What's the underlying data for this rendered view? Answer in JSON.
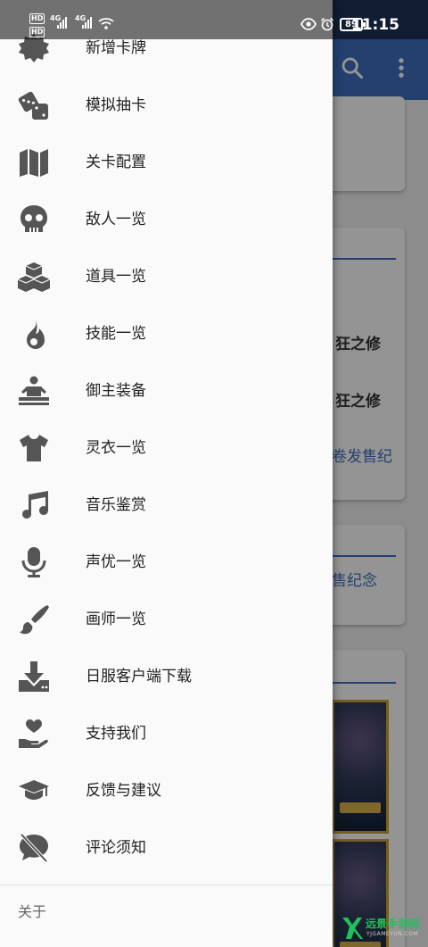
{
  "status_bar": {
    "hd_badges": [
      "HD",
      "HD"
    ],
    "network_labels": [
      "4G",
      "4G"
    ],
    "battery": "89",
    "time": "11:15"
  },
  "background": {
    "appbar_icons": [
      "search-icon",
      "more-vert-icon"
    ],
    "card_lines": [
      "狂之修",
      "狂之修"
    ],
    "link_lines": [
      "卷发售纪",
      "售纪念"
    ]
  },
  "drawer": {
    "items": [
      {
        "label": "新增卡牌",
        "icon": "gear-badge-icon"
      },
      {
        "label": "模拟抽卡",
        "icon": "dice-icon"
      },
      {
        "label": "关卡配置",
        "icon": "map-icon"
      },
      {
        "label": "敌人一览",
        "icon": "skull-icon"
      },
      {
        "label": "道具一览",
        "icon": "cubes-icon"
      },
      {
        "label": "技能一览",
        "icon": "flame-icon"
      },
      {
        "label": "御主装备",
        "icon": "person-table-icon"
      },
      {
        "label": "灵衣一览",
        "icon": "tshirt-icon"
      },
      {
        "label": "音乐鉴赏",
        "icon": "music-note-icon"
      },
      {
        "label": "声优一览",
        "icon": "microphone-icon"
      },
      {
        "label": "画师一览",
        "icon": "paintbrush-icon"
      },
      {
        "label": "日服客户端下载",
        "icon": "download-icon"
      },
      {
        "label": "支持我们",
        "icon": "hand-heart-icon"
      },
      {
        "label": "反馈与建议",
        "icon": "graduation-cap-icon"
      },
      {
        "label": "评论须知",
        "icon": "comment-off-icon"
      }
    ],
    "about_label": "关于"
  },
  "watermark": {
    "title": "远景手游网",
    "subtitle": "YJGAMEYUN.COM"
  },
  "colors": {
    "accent": "#3f6fbf",
    "icon": "#555555",
    "drawer_bg": "#fafafa",
    "watermark": "#20c05c"
  }
}
